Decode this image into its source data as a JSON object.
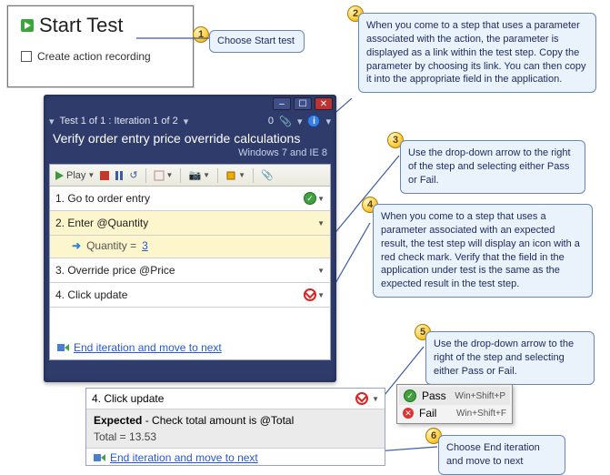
{
  "start": {
    "title": "Start Test",
    "checkbox": "Create action recording"
  },
  "callouts": {
    "c1": "Choose Start test",
    "c2": "When you come to a step that uses a parameter associated with the action, the parameter is displayed as a link within the test step. Copy the parameter by choosing its link. You can then copy it into the appropriate field in the application.",
    "c3": "Use the drop-down arrow to the right of the step and selecting either Pass or Fail.",
    "c4": "When you come to a step that uses a parameter associated with an expected result, the test step will display an icon with a red check mark. Verify that the field in the application under test is the same as the expected result in the test step.",
    "c5": "Use the drop-down arrow to the right of the step and selecting either Pass or Fail.",
    "c6": "Choose End iteration and move to next"
  },
  "runner": {
    "progress": "Test 1 of 1 : Iteration 1 of 2",
    "count": "0",
    "title": "Verify order entry price override calculations",
    "config": "Windows 7 and IE 8",
    "play": "Play"
  },
  "steps": {
    "s1": "1. Go to order entry",
    "s2": "2. Enter @Quantity",
    "s2param_label": "Quantity = ",
    "s2param_value": "3",
    "s3": "3. Override price @Price",
    "s4": "4. Click update"
  },
  "footer": {
    "link": "End iteration and move to next"
  },
  "detail": {
    "step": "4. Click update",
    "expected_label": "Expected",
    "expected_text": " - Check total amount is @Total",
    "total": "Total = 13.53",
    "link": "End iteration and move to next"
  },
  "menu": {
    "pass": "Pass",
    "pass_key": "Win+Shift+P",
    "fail": "Fail",
    "fail_key": "Win+Shift+F"
  }
}
